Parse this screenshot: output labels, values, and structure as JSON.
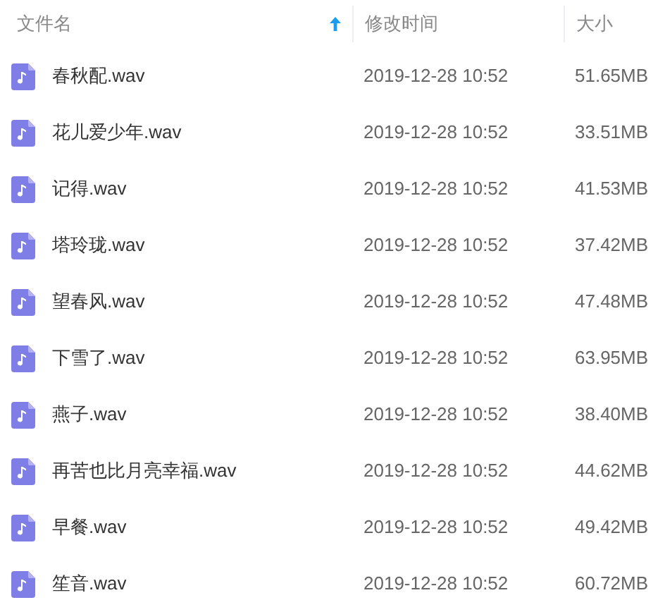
{
  "columns": [
    {
      "label": "文件名",
      "sorted": true
    },
    {
      "label": "修改时间",
      "sorted": false
    },
    {
      "label": "大小",
      "sorted": false
    }
  ],
  "files": [
    {
      "name": "春秋配.wav",
      "modified": "2019-12-28 10:52",
      "size": "51.65MB"
    },
    {
      "name": "花儿爱少年.wav",
      "modified": "2019-12-28 10:52",
      "size": "33.51MB"
    },
    {
      "name": "记得.wav",
      "modified": "2019-12-28 10:52",
      "size": "41.53MB"
    },
    {
      "name": "塔玲珑.wav",
      "modified": "2019-12-28 10:52",
      "size": "37.42MB"
    },
    {
      "name": "望春风.wav",
      "modified": "2019-12-28 10:52",
      "size": "47.48MB"
    },
    {
      "name": "下雪了.wav",
      "modified": "2019-12-28 10:52",
      "size": "63.95MB"
    },
    {
      "name": "燕子.wav",
      "modified": "2019-12-28 10:52",
      "size": "38.40MB"
    },
    {
      "name": "再苦也比月亮幸福.wav",
      "modified": "2019-12-28 10:52",
      "size": "44.62MB"
    },
    {
      "name": "早餐.wav",
      "modified": "2019-12-28 10:52",
      "size": "49.42MB"
    },
    {
      "name": "笙音.wav",
      "modified": "2019-12-28 10:52",
      "size": "60.72MB"
    }
  ]
}
